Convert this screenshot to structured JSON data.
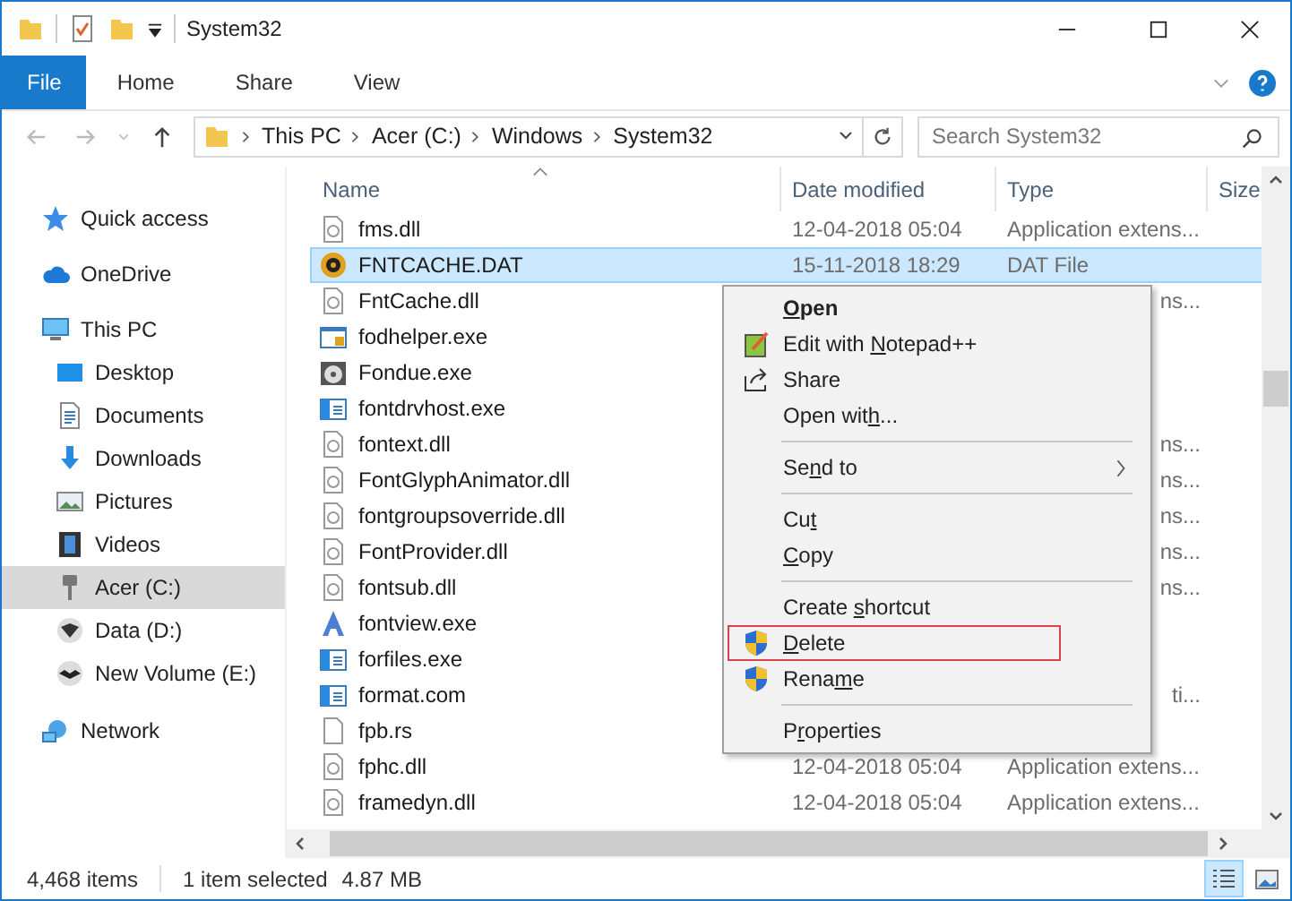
{
  "window": {
    "title": "System32"
  },
  "ribbon": {
    "tabs": [
      {
        "label": "File",
        "selected": true
      },
      {
        "label": "Home",
        "selected": false
      },
      {
        "label": "Share",
        "selected": false
      },
      {
        "label": "View",
        "selected": false
      }
    ]
  },
  "address_bar": {
    "crumbs": [
      "This PC",
      "Acer (C:)",
      "Windows",
      "System32"
    ]
  },
  "search": {
    "placeholder": "Search System32"
  },
  "sidebar": {
    "items": [
      {
        "label": "Quick access",
        "kind": "star",
        "selected": false
      },
      {
        "label": "OneDrive",
        "kind": "cloud",
        "selected": false
      },
      {
        "label": "This PC",
        "kind": "pc",
        "selected": false,
        "children": [
          {
            "label": "Desktop",
            "kind": "desktop",
            "selected": false
          },
          {
            "label": "Documents",
            "kind": "documents",
            "selected": false
          },
          {
            "label": "Downloads",
            "kind": "downloads",
            "selected": false
          },
          {
            "label": "Pictures",
            "kind": "pictures",
            "selected": false
          },
          {
            "label": "Videos",
            "kind": "videos",
            "selected": false
          },
          {
            "label": "Acer (C:)",
            "kind": "drive",
            "selected": true
          },
          {
            "label": "Data (D:)",
            "kind": "drive_d",
            "selected": false
          },
          {
            "label": "New Volume (E:)",
            "kind": "drive_e",
            "selected": false
          }
        ]
      },
      {
        "label": "Network",
        "kind": "network",
        "selected": false
      }
    ]
  },
  "file_list": {
    "columns": [
      "Name",
      "Date modified",
      "Type",
      "Size"
    ],
    "rows": [
      {
        "name": "fms.dll",
        "kind": "dll",
        "date": "12-04-2018 05:04",
        "type": "Application extens...",
        "selected": false
      },
      {
        "name": "FNTCACHE.DAT",
        "kind": "dat",
        "date": "15-11-2018 18:29",
        "type": "DAT File",
        "selected": true
      },
      {
        "name": "FntCache.dll",
        "kind": "dll",
        "type_tail": "ns...",
        "selected": false
      },
      {
        "name": "fodhelper.exe",
        "kind": "exe_app",
        "selected": false
      },
      {
        "name": "Fondue.exe",
        "kind": "disc",
        "selected": false
      },
      {
        "name": "fontdrvhost.exe",
        "kind": "app",
        "selected": false
      },
      {
        "name": "fontext.dll",
        "kind": "dll",
        "type_tail": "ns...",
        "selected": false
      },
      {
        "name": "FontGlyphAnimator.dll",
        "kind": "dll",
        "type_tail": "ns...",
        "selected": false
      },
      {
        "name": "fontgroupsoverride.dll",
        "kind": "dll",
        "type_tail": "ns...",
        "selected": false
      },
      {
        "name": "FontProvider.dll",
        "kind": "dll",
        "type_tail": "ns...",
        "selected": false
      },
      {
        "name": "fontsub.dll",
        "kind": "dll",
        "type_tail": "ns...",
        "selected": false
      },
      {
        "name": "fontview.exe",
        "kind": "fontview",
        "selected": false
      },
      {
        "name": "forfiles.exe",
        "kind": "app",
        "selected": false
      },
      {
        "name": "format.com",
        "kind": "app",
        "type_tail": "ti...",
        "selected": false
      },
      {
        "name": "fpb.rs",
        "kind": "blank",
        "selected": false
      },
      {
        "name": "fphc.dll",
        "kind": "dll",
        "date": "12-04-2018 05:04",
        "type": "Application extens...",
        "selected": false
      },
      {
        "name": "framedyn.dll",
        "kind": "dll",
        "date": "12-04-2018 05:04",
        "type": "Application extens...",
        "selected": false
      }
    ]
  },
  "context_menu": {
    "items": [
      {
        "kind": "item",
        "key": "O",
        "after": "pen",
        "bold": true,
        "highlighted": false,
        "submenu": false
      },
      {
        "kind": "notepad_item",
        "before": "Edit with ",
        "key": "N",
        "after": "otepad++",
        "bold": false,
        "highlighted": false,
        "submenu": false
      },
      {
        "kind": "share_item",
        "before": "Share",
        "bold": false,
        "highlighted": false,
        "submenu": false
      },
      {
        "kind": "item",
        "before": "Open wit",
        "key": "h",
        "after": "...",
        "bold": false,
        "highlighted": false,
        "submenu": false
      },
      {
        "kind": "separator"
      },
      {
        "kind": "item",
        "before": "Se",
        "key": "n",
        "after": "d to",
        "bold": false,
        "highlighted": false,
        "submenu": true
      },
      {
        "kind": "separator"
      },
      {
        "kind": "item",
        "before": "Cu",
        "key": "t",
        "bold": false,
        "highlighted": false,
        "submenu": false
      },
      {
        "kind": "item",
        "key": "C",
        "after": "opy",
        "bold": false,
        "highlighted": false,
        "submenu": false
      },
      {
        "kind": "separator"
      },
      {
        "kind": "item",
        "before": "Create ",
        "key": "s",
        "after": "hortcut",
        "bold": false,
        "highlighted": false,
        "submenu": false
      },
      {
        "kind": "shield_item",
        "key": "D",
        "after": "elete",
        "bold": false,
        "highlighted": true,
        "submenu": false
      },
      {
        "kind": "shield_item",
        "before": "Rena",
        "key": "m",
        "after": "e",
        "bold": false,
        "highlighted": false,
        "submenu": false
      },
      {
        "kind": "separator"
      },
      {
        "kind": "item",
        "before": "P",
        "key": "r",
        "after": "operties",
        "bold": false,
        "highlighted": false,
        "submenu": false
      }
    ]
  },
  "status_bar": {
    "item_count": "4,468 items",
    "selection": "1 item selected",
    "size": "4.87 MB",
    "views": [
      {
        "kind": "details",
        "selected": true
      },
      {
        "kind": "large_icons",
        "selected": false
      }
    ]
  }
}
